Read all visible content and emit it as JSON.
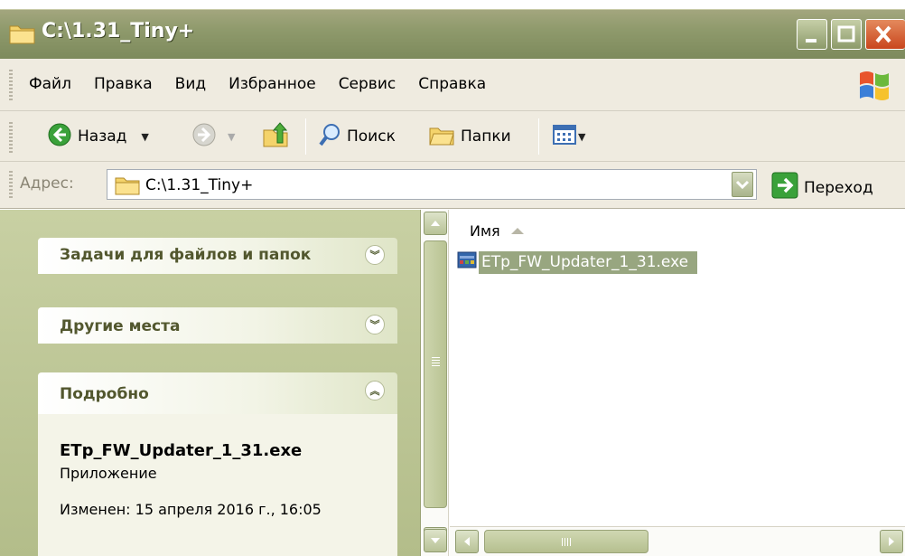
{
  "window": {
    "title": "C:\\1.31_Tiny+"
  },
  "menu": {
    "items": [
      {
        "label": "Файл"
      },
      {
        "label": "Правка"
      },
      {
        "label": "Вид"
      },
      {
        "label": "Избранное"
      },
      {
        "label": "Сервис"
      },
      {
        "label": "Справка"
      }
    ]
  },
  "toolbar": {
    "back_label": "Назад",
    "search_label": "Поиск",
    "folders_label": "Папки"
  },
  "address": {
    "label": "Адрес:",
    "value": "C:\\1.31_Tiny+",
    "go_label": "Переход"
  },
  "taskpane": {
    "file_tasks_title": "Задачи для файлов и папок",
    "other_places_title": "Другие места",
    "details_title": "Подробно",
    "details": {
      "name": "ETp_FW_Updater_1_31.exe",
      "type": "Приложение",
      "modified": "Изменен: 15 апреля 2016 г., 16:05"
    }
  },
  "filelist": {
    "column_name": "Имя",
    "files": [
      {
        "name": "ETp_FW_Updater_1_31.exe",
        "selected": true
      }
    ]
  },
  "colors": {
    "selection": "#98a680",
    "taskpane_bg": "#c8d0a3",
    "chrome_bg": "#efebe0"
  }
}
